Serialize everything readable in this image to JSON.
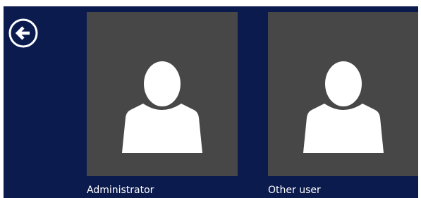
{
  "back_button": {
    "icon": "back-arrow-icon"
  },
  "users": [
    {
      "name": "Administrator",
      "icon": "user-avatar-icon"
    },
    {
      "name": "Other user",
      "icon": "user-avatar-icon"
    }
  ],
  "colors": {
    "background": "#0b1b4e",
    "tile": "#474747",
    "avatar": "#ffffff",
    "text": "#ffffff"
  }
}
